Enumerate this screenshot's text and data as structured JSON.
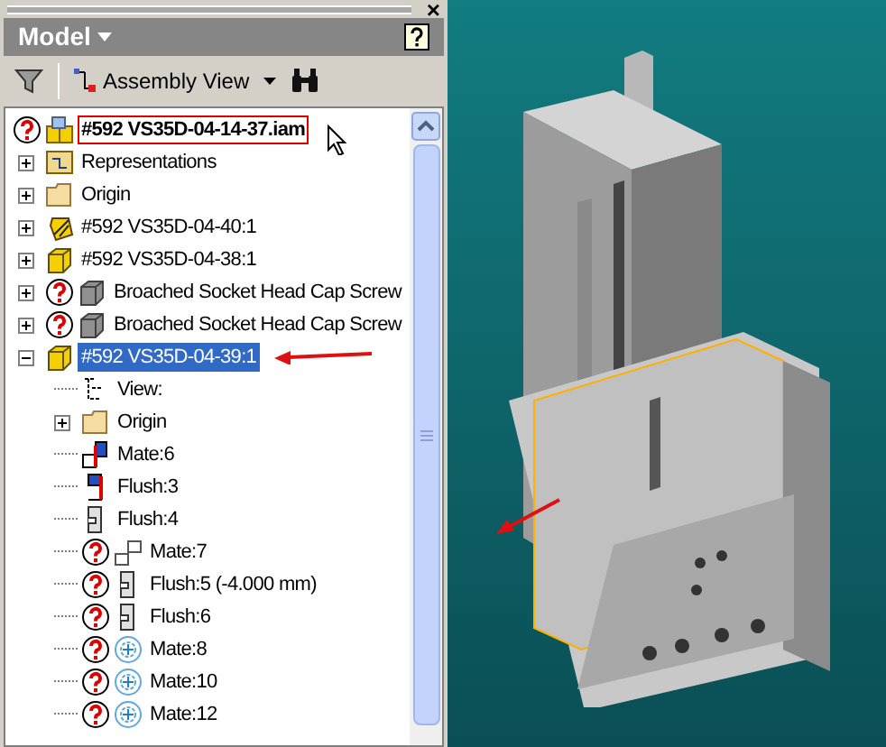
{
  "panel": {
    "close": "×",
    "title": "Model",
    "toolbar": {
      "view_label": "Assembly View"
    }
  },
  "tree": {
    "items": [
      {
        "label": "#592 VS35D-04-14-37.iam",
        "kind": "assembly",
        "warning": true,
        "boxed": true,
        "selected": false,
        "children": [
          {
            "label": "Representations",
            "kind": "representations",
            "warning": false,
            "expanded": false,
            "selected": false
          },
          {
            "label": "Origin",
            "kind": "folder",
            "warning": false,
            "expanded": false,
            "selected": false
          },
          {
            "label": "#592 VS35D-04-40:1",
            "kind": "flexible",
            "warning": false,
            "expanded": false,
            "selected": false
          },
          {
            "label": "#592 VS35D-04-38:1",
            "kind": "part",
            "warning": false,
            "expanded": false,
            "selected": false
          },
          {
            "label": "Broached Socket Head Cap Screw",
            "kind": "screw",
            "warning": true,
            "expanded": false,
            "selected": false
          },
          {
            "label": "Broached Socket Head Cap Screw",
            "kind": "screw",
            "warning": true,
            "expanded": false,
            "selected": false
          },
          {
            "label": "#592 VS35D-04-39:1",
            "kind": "part",
            "warning": false,
            "expanded": true,
            "selected": true,
            "children": [
              {
                "label": "View:",
                "kind": "view",
                "warning": false,
                "selected": false
              },
              {
                "label": "Origin",
                "kind": "folder",
                "warning": false,
                "expanded": false,
                "selected": false
              },
              {
                "label": "Mate:6",
                "kind": "mate-red",
                "warning": false,
                "selected": false
              },
              {
                "label": "Flush:3",
                "kind": "flush-red",
                "warning": false,
                "selected": false
              },
              {
                "label": "Flush:4",
                "kind": "flush",
                "warning": false,
                "selected": false
              },
              {
                "label": "Mate:7",
                "kind": "mate",
                "warning": true,
                "selected": false
              },
              {
                "label": "Flush:5 (-4.000 mm)",
                "kind": "flush",
                "warning": true,
                "selected": false
              },
              {
                "label": "Flush:6",
                "kind": "flush",
                "warning": true,
                "selected": false
              },
              {
                "label": "Mate:8",
                "kind": "axis",
                "warning": true,
                "selected": false
              },
              {
                "label": "Mate:10",
                "kind": "axis",
                "warning": true,
                "selected": false
              },
              {
                "label": "Mate:12",
                "kind": "axis",
                "warning": true,
                "selected": false
              }
            ]
          }
        ]
      }
    ]
  }
}
